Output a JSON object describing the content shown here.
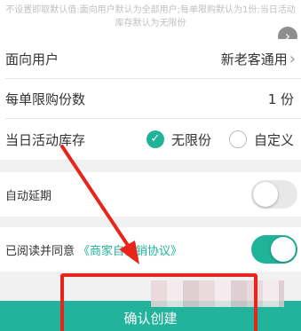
{
  "hint": {
    "line1": "不设置即取默认值:面向用户默认为全部用户;每单限购默认为1份;当日活动",
    "line2": "库存默认为无限份"
  },
  "rows": {
    "audience": {
      "label": "面向用户",
      "value": "新老客通用"
    },
    "limit": {
      "label": "每单限购份数",
      "value": "1 份"
    },
    "stock": {
      "label": "当日活动库存",
      "option_unlimited": "无限份",
      "option_custom": "自定义",
      "selected": "无限份"
    },
    "auto_extend": {
      "label": "自动延期",
      "enabled": false
    },
    "agreement": {
      "label": "已阅读并同意",
      "link": "《商家自营销协议》",
      "enabled": true
    }
  },
  "confirm_button": {
    "label": "确认创建"
  },
  "colors": {
    "accent": "#1fb39a",
    "annotation": "#e8251c"
  }
}
